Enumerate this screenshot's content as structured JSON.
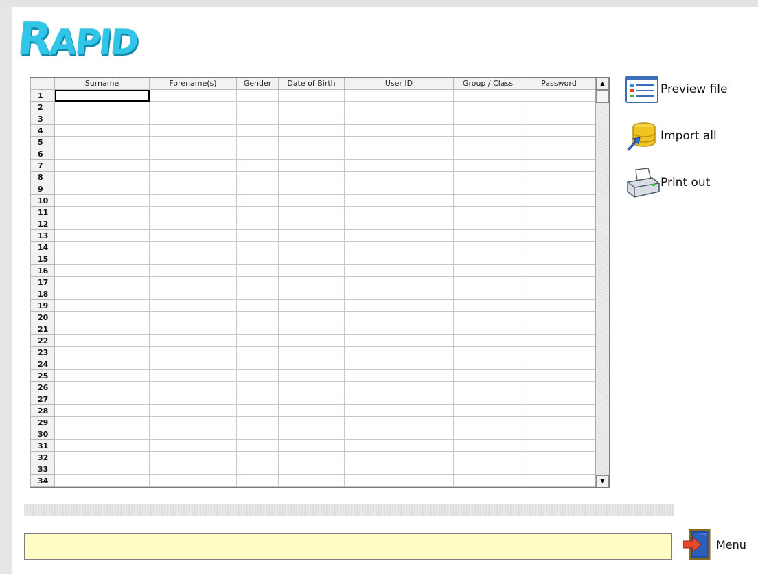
{
  "app": {
    "logo_text": "RAPID",
    "logo_first": "R",
    "logo_rest": "APID"
  },
  "grid": {
    "columns": [
      "",
      "Surname",
      "Forename(s)",
      "Gender",
      "Date of Birth",
      "User ID",
      "Group / Class",
      "Password"
    ],
    "row_numbers": [
      "1",
      "2",
      "3",
      "4",
      "5",
      "6",
      "7",
      "8",
      "9",
      "10",
      "11",
      "12",
      "13",
      "14",
      "15",
      "16",
      "17",
      "18",
      "19",
      "20",
      "21",
      "22",
      "23",
      "24",
      "25",
      "26",
      "27",
      "28",
      "29",
      "30",
      "31",
      "32",
      "33",
      "34"
    ],
    "active_cell": {
      "row": 1,
      "column": "Surname"
    },
    "scroll_up_icon": "triangle-up",
    "scroll_down_icon": "triangle-down"
  },
  "actions": {
    "preview_label": "Preview file",
    "import_label": "Import all",
    "print_label": "Print out",
    "preview_icon": "preview-table-icon",
    "import_icon": "database-import-icon",
    "print_icon": "printer-icon"
  },
  "status": {
    "message": "",
    "background_color": "#fffcc4"
  },
  "menu": {
    "label": "Menu",
    "icon": "exit-door-icon"
  },
  "colors": {
    "logo": "#2fc6e8",
    "logo_shadow": "#128aad"
  }
}
